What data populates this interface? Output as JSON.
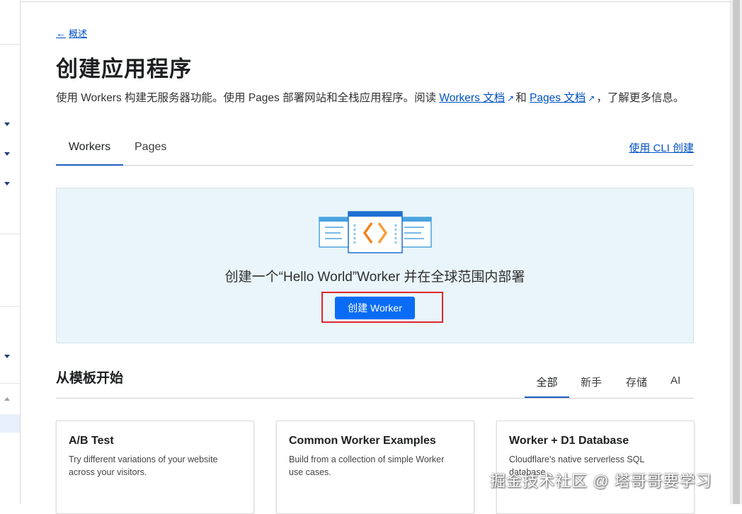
{
  "breadcrumb": {
    "arrow": "←",
    "label": "概述"
  },
  "page": {
    "title": "创建应用程序",
    "description_prefix": "使用 Workers 构建无服务器功能。使用 Pages 部署网站和全栈应用程序。阅读 ",
    "workers_docs_link": "Workers 文档",
    "desc_and": "和 ",
    "pages_docs_link": "Pages 文档",
    "description_suffix": "，了解更多信息。",
    "external_icon": "↗"
  },
  "tabs": [
    {
      "label": "Workers",
      "active": true
    },
    {
      "label": "Pages",
      "active": false
    }
  ],
  "cli_link": "使用 CLI 创建",
  "hero": {
    "text": "创建一个“Hello World”Worker 并在全球范围内部署",
    "button": "创建 Worker",
    "illustration_icon": "workers-logo-icon"
  },
  "templates": {
    "title": "从模板开始",
    "filters": [
      {
        "label": "全部",
        "active": true
      },
      {
        "label": "新手",
        "active": false
      },
      {
        "label": "存储",
        "active": false
      },
      {
        "label": "AI",
        "active": false
      }
    ],
    "cards": [
      {
        "title": "A/B Test",
        "desc": "Try different variations of your website across your visitors."
      },
      {
        "title": "Common Worker Examples",
        "desc": "Build from a collection of simple Worker use cases."
      },
      {
        "title": "Worker + D1 Database",
        "desc": "Cloudflare's native serverless SQL database."
      }
    ]
  },
  "watermark": "掘金技术社区 @ 塔哥哥要学习",
  "colors": {
    "accent": "#0a6cf5",
    "link": "#0051c3",
    "hero_bg": "#e9f5fa",
    "highlight": "#e0262e"
  }
}
